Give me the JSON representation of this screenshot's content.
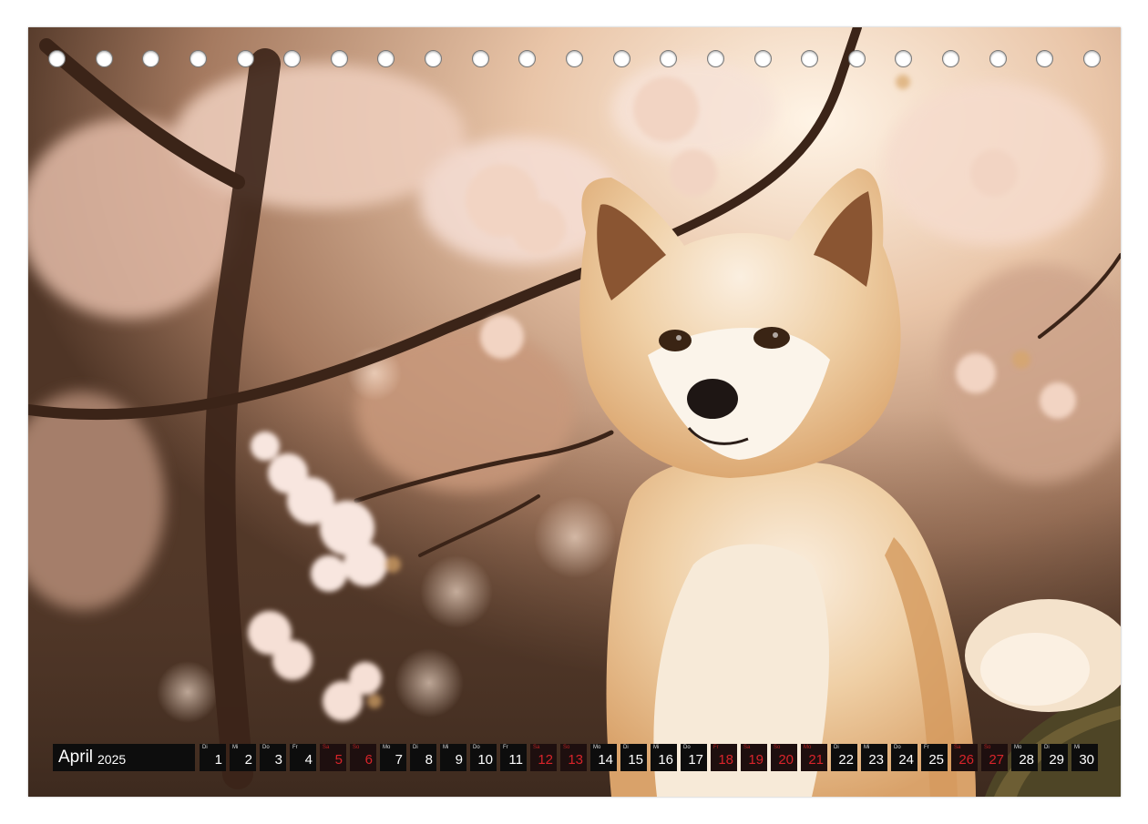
{
  "calendar": {
    "month": "April",
    "year": "2025",
    "days": [
      {
        "wd": "Di",
        "n": "1",
        "we": false
      },
      {
        "wd": "Mi",
        "n": "2",
        "we": false
      },
      {
        "wd": "Do",
        "n": "3",
        "we": false
      },
      {
        "wd": "Fr",
        "n": "4",
        "we": false
      },
      {
        "wd": "Sa",
        "n": "5",
        "we": true
      },
      {
        "wd": "So",
        "n": "6",
        "we": true
      },
      {
        "wd": "Mo",
        "n": "7",
        "we": false
      },
      {
        "wd": "Di",
        "n": "8",
        "we": false
      },
      {
        "wd": "Mi",
        "n": "9",
        "we": false
      },
      {
        "wd": "Do",
        "n": "10",
        "we": false
      },
      {
        "wd": "Fr",
        "n": "11",
        "we": false
      },
      {
        "wd": "Sa",
        "n": "12",
        "we": true
      },
      {
        "wd": "So",
        "n": "13",
        "we": true
      },
      {
        "wd": "Mo",
        "n": "14",
        "we": false
      },
      {
        "wd": "Di",
        "n": "15",
        "we": false
      },
      {
        "wd": "Mi",
        "n": "16",
        "we": false
      },
      {
        "wd": "Do",
        "n": "17",
        "we": false
      },
      {
        "wd": "Fr",
        "n": "18",
        "we": true
      },
      {
        "wd": "Sa",
        "n": "19",
        "we": true
      },
      {
        "wd": "So",
        "n": "20",
        "we": true
      },
      {
        "wd": "Mo",
        "n": "21",
        "we": true
      },
      {
        "wd": "Di",
        "n": "22",
        "we": false
      },
      {
        "wd": "Mi",
        "n": "23",
        "we": false
      },
      {
        "wd": "Do",
        "n": "24",
        "we": false
      },
      {
        "wd": "Fr",
        "n": "25",
        "we": false
      },
      {
        "wd": "Sa",
        "n": "26",
        "we": true
      },
      {
        "wd": "So",
        "n": "27",
        "we": true
      },
      {
        "wd": "Mo",
        "n": "28",
        "we": false
      },
      {
        "wd": "Di",
        "n": "29",
        "we": false
      },
      {
        "wd": "Mi",
        "n": "30",
        "we": false
      }
    ]
  },
  "colors": {
    "bar_bg": "#0d0d0d",
    "weekend_text": "#d8242a",
    "fur": "#e2b685",
    "blossom": "#f6dfd6"
  },
  "binding_holes": 23
}
